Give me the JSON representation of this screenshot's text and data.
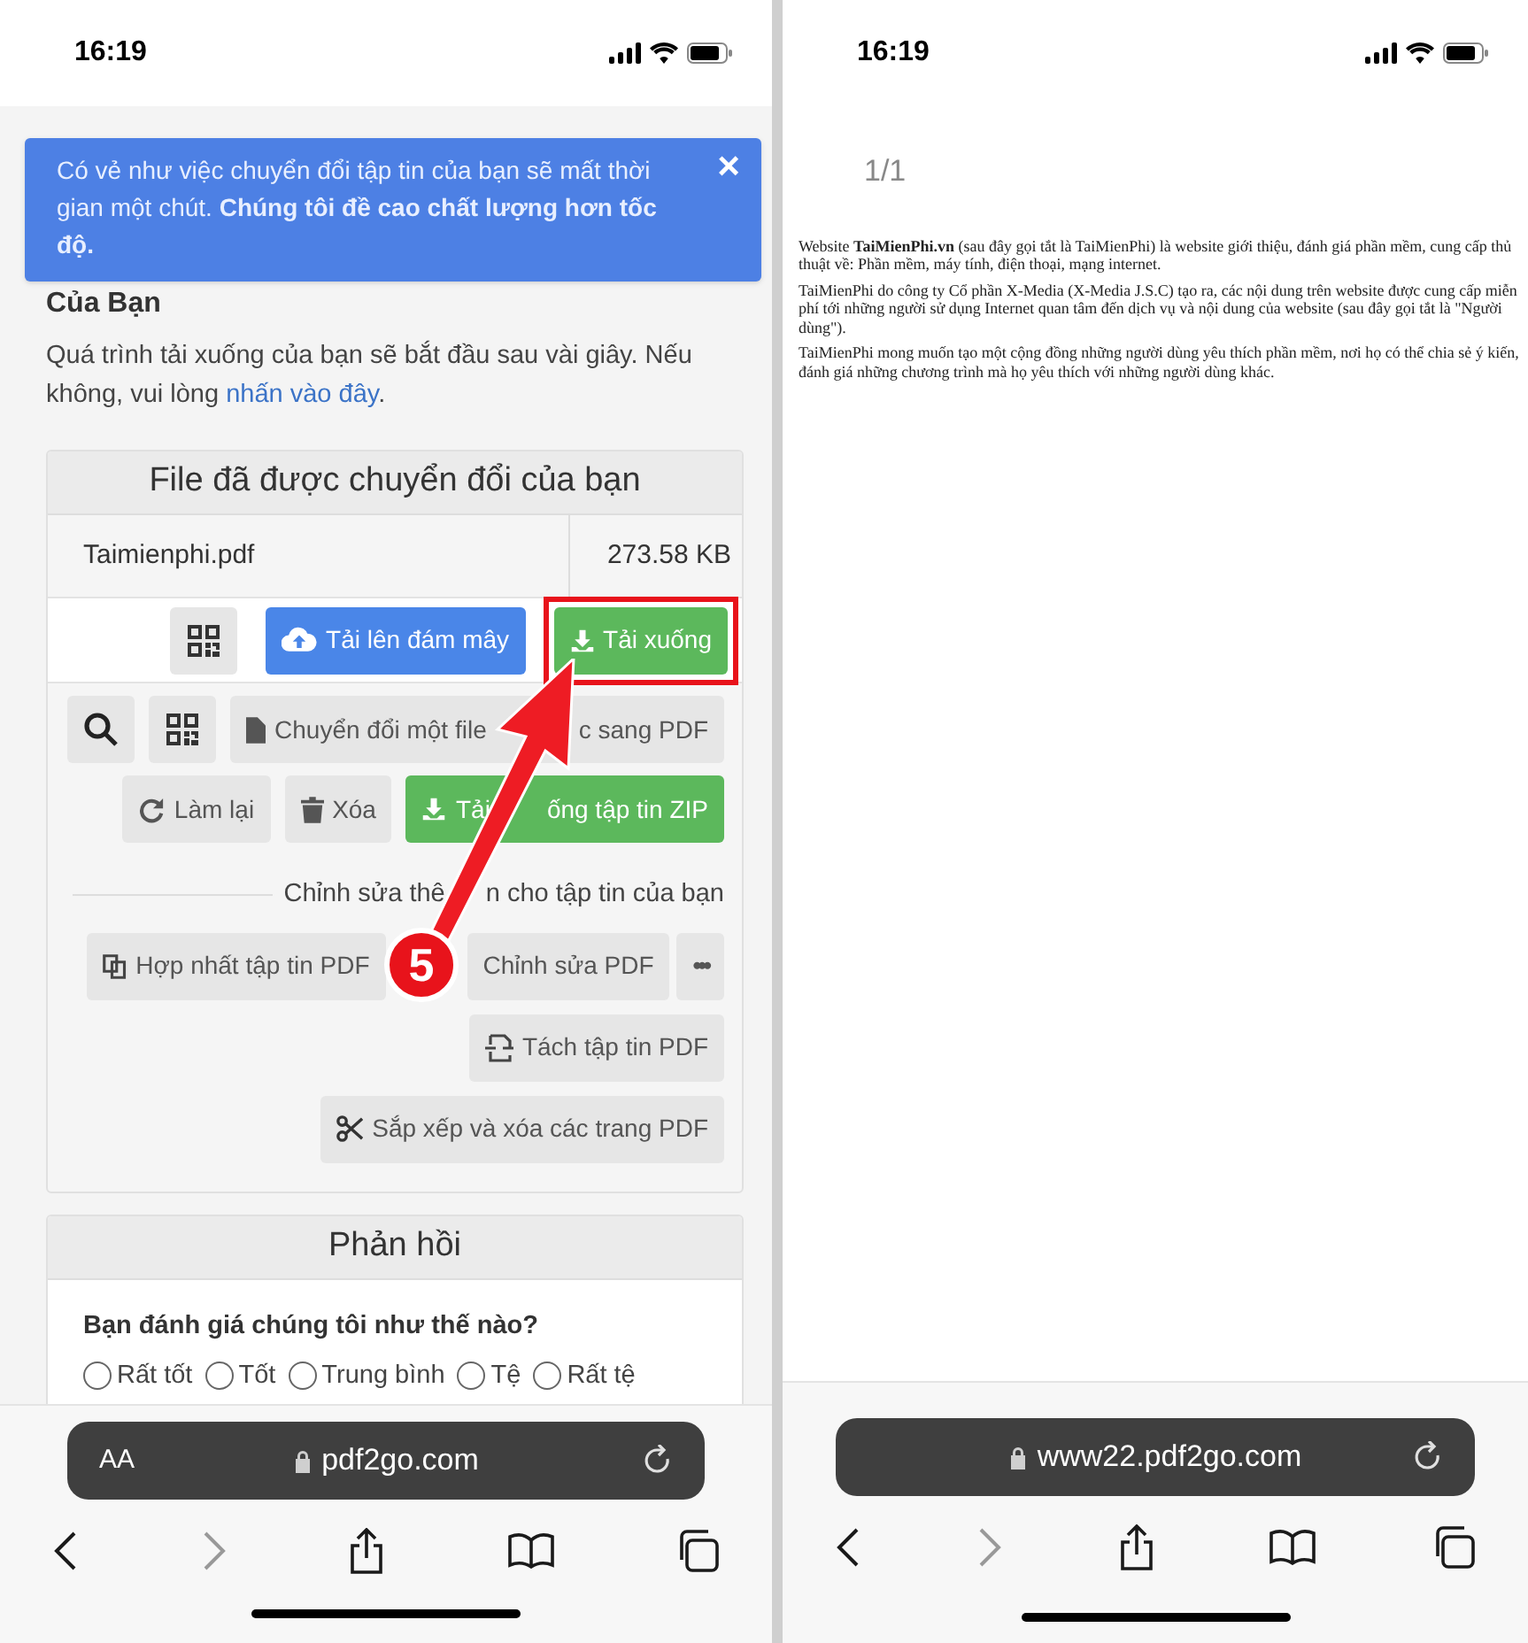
{
  "left_phone": {
    "status_bar": {
      "time": "16:19"
    },
    "toast": {
      "text": "Có vẻ như việc chuyển đổi tập tin của bạn sẽ mất thời gian một chút. **Chúng tôi đề cao chất lượng hơn tốc độ.**",
      "close": "×"
    },
    "heading": "Của Bạn",
    "notice": {
      "text": "Quá trình tải xuống của bạn sẽ bắt đầu sau vài giây. Nếu không, vui lòng",
      "link": "nhấn vào đây",
      "end": "."
    },
    "converted_card": {
      "title": "File đã được chuyển đổi của bạn",
      "file": {
        "name": "Taimienphi.pdf",
        "size": "273.58 KB"
      },
      "primary_actions": [
        {
          "kind": "qr",
          "highlighted": false
        },
        {
          "kind": "cloud",
          "label_parts": [
            "Tải lên đám mây"
          ],
          "highlighted": false
        },
        {
          "kind": "download",
          "label_parts": [
            "Tải xuống"
          ],
          "highlighted": true
        }
      ],
      "tool_rows": [
        [
          {
            "kind": "search"
          },
          {
            "kind": "qr"
          },
          {
            "kind": "file",
            "label_parts": [
              "Chuyển đổi một file",
              "c sang PDF"
            ]
          }
        ],
        [
          {
            "kind": "redo",
            "label_parts": [
              "Làm lại"
            ]
          },
          {
            "kind": "trash",
            "label_parts": [
              "Xóa"
            ]
          },
          {
            "kind": "zip",
            "label_parts": [
              "Tải",
              "ống tập tin ZIP"
            ]
          }
        ]
      ],
      "more_caption_parts": [
        "Chỉnh sửa thê",
        "n cho tập tin của bạn"
      ],
      "more_rows": [
        [
          {
            "kind": "merge",
            "label_parts": [
              "Hợp nhất tập tin PDF"
            ]
          },
          {
            "kind": "edit",
            "label_parts": [
              "Chỉnh sửa PDF"
            ]
          },
          {
            "kind": "more",
            "label_parts": [
              "•••"
            ]
          }
        ],
        [
          {
            "kind": "split",
            "label_parts": [
              "Tách tập tin PDF"
            ]
          }
        ],
        [
          {
            "kind": "scissors",
            "label_parts": [
              "Sắp xếp và xóa các trang PDF"
            ]
          }
        ]
      ]
    },
    "annotation": {
      "step": "5"
    },
    "feedback": {
      "title": "Phản hồi",
      "question": "Bạn đánh giá chúng tôi như thế nào?",
      "options": [
        {
          "label": "Rất tốt",
          "selected": false
        },
        {
          "label": "Tốt",
          "selected": false
        },
        {
          "label": "Trung bình",
          "selected": false
        },
        {
          "label": "Tệ",
          "selected": false
        },
        {
          "label": "Rất tệ",
          "selected": false
        }
      ]
    },
    "browser_bar": {
      "text_size": "AA",
      "url": "pdf2go.com"
    }
  },
  "right_phone": {
    "status_bar": {
      "time": "16:19"
    },
    "page_indicator": "1/1",
    "document": [
      "Website **TaiMienPhi.vn** (sau đây gọi tắt là TaiMienPhi) là website giới thiệu, đánh giá phần mềm, cung cấp thủ thuật về: Phần mềm, máy tính, điện thoại, mạng internet.",
      "TaiMienPhi do công ty Cổ phần X-Media (X-Media J.S.C) tạo ra, các nội dung trên website được cung cấp miễn phí tới những người sử dụng Internet quan tâm đến dịch vụ và nội dung của website (sau đây gọi tắt là \"Người dùng\").",
      "TaiMienPhi mong muốn tạo một cộng đồng những người dùng yêu thích phần mềm, nơi họ có thể chia sẻ ý kiến, đánh giá những chương trình mà họ yêu thích với những người dùng khác."
    ],
    "browser_bar": {
      "url": "www22.pdf2go.com"
    }
  }
}
